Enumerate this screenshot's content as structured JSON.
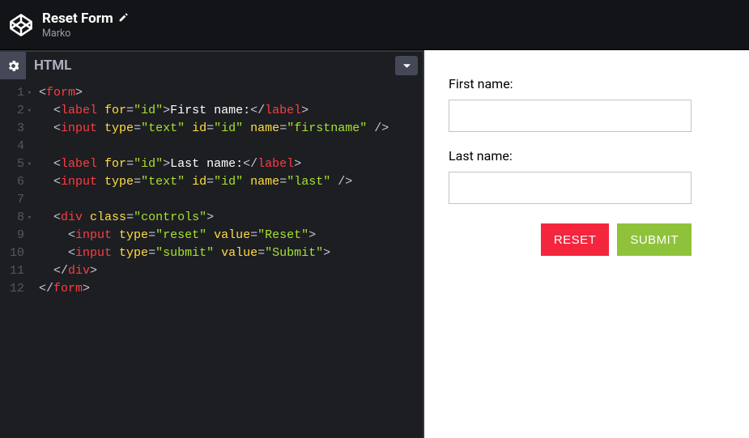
{
  "header": {
    "title": "Reset Form",
    "author": "Marko"
  },
  "editor": {
    "tab_label": "HTML",
    "lines": [
      1,
      2,
      3,
      4,
      5,
      6,
      7,
      8,
      9,
      10,
      11,
      12
    ],
    "fold_lines": [
      1,
      2,
      5,
      8
    ],
    "tokens": [
      [
        [
          "<",
          "punct"
        ],
        [
          "form",
          "tag"
        ],
        [
          ">",
          "punct"
        ]
      ],
      [
        [
          "  <",
          "punct"
        ],
        [
          "label",
          "tag"
        ],
        [
          " ",
          "punct"
        ],
        [
          "for",
          "attr"
        ],
        [
          "=",
          "punct"
        ],
        [
          "\"id\"",
          "str"
        ],
        [
          ">",
          "punct"
        ],
        [
          "First name:",
          "text"
        ],
        [
          "</",
          "punct"
        ],
        [
          "label",
          "tag"
        ],
        [
          ">",
          "punct"
        ]
      ],
      [
        [
          "  <",
          "punct"
        ],
        [
          "input",
          "tag"
        ],
        [
          " ",
          "punct"
        ],
        [
          "type",
          "attr"
        ],
        [
          "=",
          "punct"
        ],
        [
          "\"text\"",
          "str"
        ],
        [
          " ",
          "punct"
        ],
        [
          "id",
          "attr"
        ],
        [
          "=",
          "punct"
        ],
        [
          "\"id\"",
          "str"
        ],
        [
          " ",
          "punct"
        ],
        [
          "name",
          "attr"
        ],
        [
          "=",
          "punct"
        ],
        [
          "\"firstname\"",
          "str"
        ],
        [
          " />",
          "punct"
        ]
      ],
      [],
      [
        [
          "  <",
          "punct"
        ],
        [
          "label",
          "tag"
        ],
        [
          " ",
          "punct"
        ],
        [
          "for",
          "attr"
        ],
        [
          "=",
          "punct"
        ],
        [
          "\"id\"",
          "str"
        ],
        [
          ">",
          "punct"
        ],
        [
          "Last name:",
          "text"
        ],
        [
          "</",
          "punct"
        ],
        [
          "label",
          "tag"
        ],
        [
          ">",
          "punct"
        ]
      ],
      [
        [
          "  <",
          "punct"
        ],
        [
          "input",
          "tag"
        ],
        [
          " ",
          "punct"
        ],
        [
          "type",
          "attr"
        ],
        [
          "=",
          "punct"
        ],
        [
          "\"text\"",
          "str"
        ],
        [
          " ",
          "punct"
        ],
        [
          "id",
          "attr"
        ],
        [
          "=",
          "punct"
        ],
        [
          "\"id\"",
          "str"
        ],
        [
          " ",
          "punct"
        ],
        [
          "name",
          "attr"
        ],
        [
          "=",
          "punct"
        ],
        [
          "\"last\"",
          "str"
        ],
        [
          " />",
          "punct"
        ]
      ],
      [],
      [
        [
          "  <",
          "punct"
        ],
        [
          "div",
          "tag"
        ],
        [
          " ",
          "punct"
        ],
        [
          "class",
          "attr"
        ],
        [
          "=",
          "punct"
        ],
        [
          "\"controls\"",
          "str"
        ],
        [
          ">",
          "punct"
        ]
      ],
      [
        [
          "    <",
          "punct"
        ],
        [
          "input",
          "tag"
        ],
        [
          " ",
          "punct"
        ],
        [
          "type",
          "attr"
        ],
        [
          "=",
          "punct"
        ],
        [
          "\"reset\"",
          "str"
        ],
        [
          " ",
          "punct"
        ],
        [
          "value",
          "attr"
        ],
        [
          "=",
          "punct"
        ],
        [
          "\"Reset\"",
          "str"
        ],
        [
          ">",
          "punct"
        ]
      ],
      [
        [
          "    <",
          "punct"
        ],
        [
          "input",
          "tag"
        ],
        [
          " ",
          "punct"
        ],
        [
          "type",
          "attr"
        ],
        [
          "=",
          "punct"
        ],
        [
          "\"submit\"",
          "str"
        ],
        [
          " ",
          "punct"
        ],
        [
          "value",
          "attr"
        ],
        [
          "=",
          "punct"
        ],
        [
          "\"Submit\"",
          "str"
        ],
        [
          ">",
          "punct"
        ]
      ],
      [
        [
          "  </",
          "punct"
        ],
        [
          "div",
          "tag"
        ],
        [
          ">",
          "punct"
        ]
      ],
      [
        [
          "</",
          "punct"
        ],
        [
          "form",
          "tag"
        ],
        [
          ">",
          "punct"
        ]
      ]
    ]
  },
  "form": {
    "first_label": "First name:",
    "last_label": "Last name:",
    "reset_label": "RESET",
    "submit_label": "SUBMIT"
  }
}
